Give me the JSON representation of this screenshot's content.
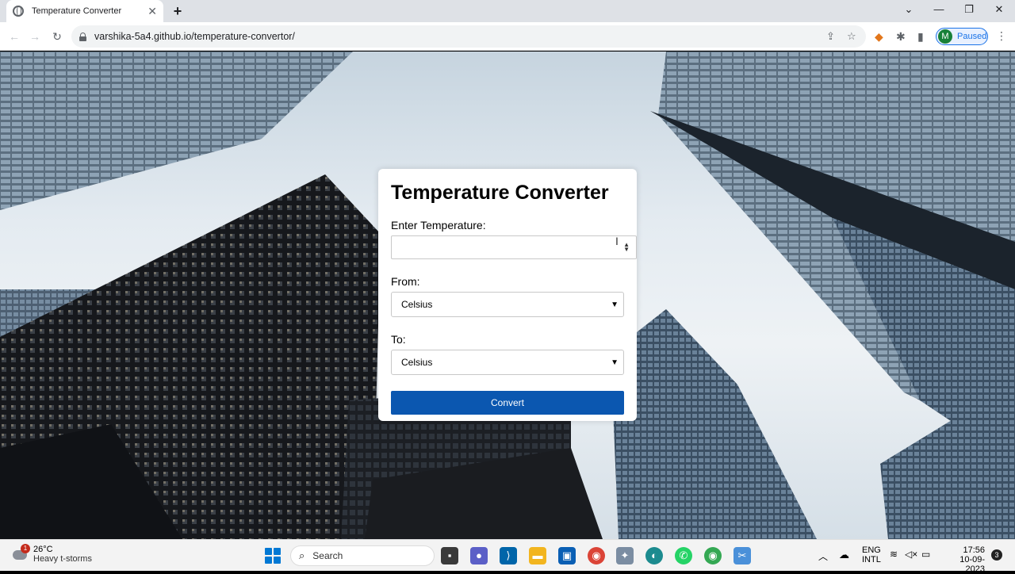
{
  "browser": {
    "tab_title": "Temperature Converter",
    "tab_close": "✕",
    "new_tab": "+",
    "url": "varshika-5a4.github.io/temperature-convertor/",
    "profile_initial": "M",
    "profile_status": "Paused"
  },
  "app": {
    "title": "Temperature Converter",
    "temp_label": "Enter Temperature:",
    "temp_value": "",
    "from_label": "From:",
    "from_value": "Celsius",
    "to_label": "To:",
    "to_value": "Celsius",
    "convert_label": "Convert"
  },
  "taskbar": {
    "weather_badge": "1",
    "weather_temp": "26°C",
    "weather_desc": "Heavy t-storms",
    "search_placeholder": "Search",
    "lang_top": "ENG",
    "lang_bottom": "INTL",
    "time": "17:56",
    "date": "10-09-2023",
    "notif_count": "3"
  }
}
